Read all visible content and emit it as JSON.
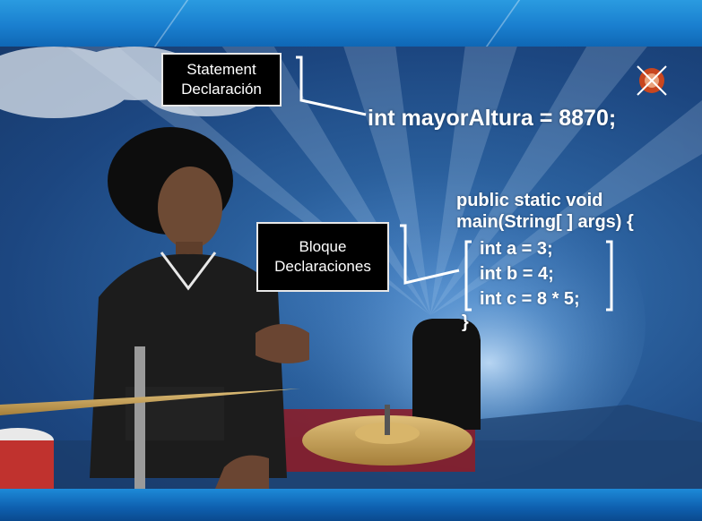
{
  "annotations": {
    "statement": {
      "line1": "Statement",
      "line2": "Declaración"
    },
    "bloque": {
      "line1": "Bloque",
      "line2": "Declaraciones"
    }
  },
  "code": {
    "statement_line": "int mayorAltura = 8870;",
    "method_line1": "public static void",
    "method_line2": "main(String[ ] args) {",
    "block_lines": [
      "int a = 3;",
      "int b = 4;",
      "int c = 8 * 5;"
    ],
    "closing": "}"
  },
  "colors": {
    "label_bg": "#000000",
    "label_border": "#e8e8e8",
    "code_text": "#ffffff",
    "banner": "#1a7fcf"
  }
}
